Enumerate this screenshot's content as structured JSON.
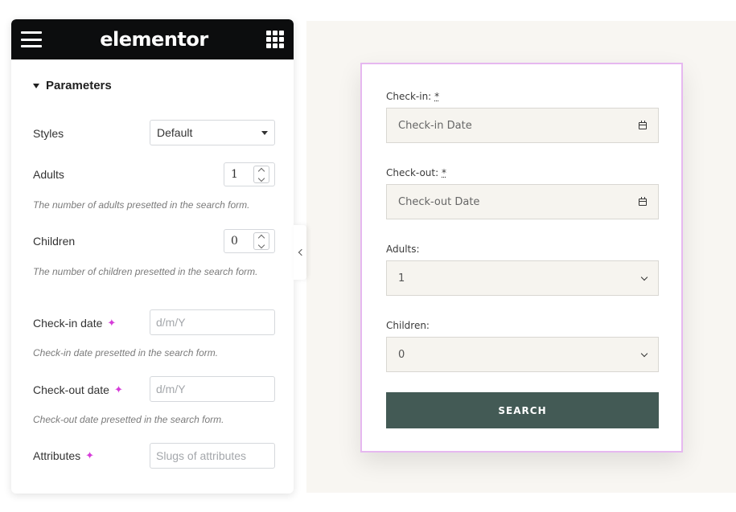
{
  "panel": {
    "brand": "elementor",
    "section_title": "Parameters",
    "styles": {
      "label": "Styles",
      "value": "Default"
    },
    "adults": {
      "label": "Adults",
      "value": "1",
      "description": "The number of adults presetted in the search form."
    },
    "children": {
      "label": "Children",
      "value": "0",
      "description": "The number of children presetted in the search form."
    },
    "checkin": {
      "label": "Check-in date",
      "placeholder": "d/m/Y",
      "description": "Check-in date presetted in the search form."
    },
    "checkout": {
      "label": "Check-out date",
      "placeholder": "d/m/Y",
      "description": "Check-out date presetted in the search form."
    },
    "attributes": {
      "label": "Attributes",
      "placeholder": "Slugs of attributes"
    },
    "icons": {
      "menu": "hamburger-icon",
      "apps": "grid-icon",
      "dynamic": "sparkle-icon",
      "collapse": "chevron-left-icon"
    }
  },
  "form": {
    "checkin": {
      "label": "Check-in:",
      "required_mark": "*",
      "placeholder": "Check-in Date"
    },
    "checkout": {
      "label": "Check-out:",
      "required_mark": "*",
      "placeholder": "Check-out Date"
    },
    "adults": {
      "label": "Adults:",
      "value": "1"
    },
    "children": {
      "label": "Children:",
      "value": "0"
    },
    "search_label": "SEARCH"
  },
  "colors": {
    "header_bg": "#0c0d0e",
    "accent_pink": "#d63cd9",
    "button_bg": "#435a55",
    "preview_bg": "#f8f6f2"
  }
}
